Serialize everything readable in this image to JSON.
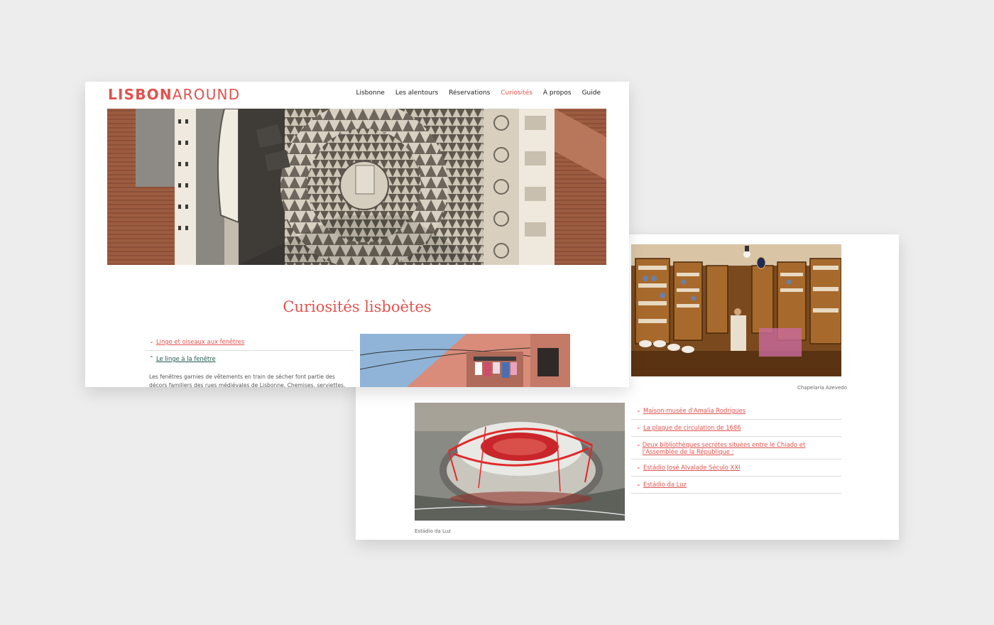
{
  "front": {
    "logo": {
      "bold": "LISBON",
      "light": "AROUND"
    },
    "nav": [
      {
        "label": "Lisbonne",
        "active": false
      },
      {
        "label": "Les alentours",
        "active": false
      },
      {
        "label": "Réservations",
        "active": false
      },
      {
        "label": "Curiosités",
        "active": true
      },
      {
        "label": "À propos",
        "active": false
      },
      {
        "label": "Guide",
        "active": false
      }
    ],
    "title": "Curiosités lisboètes",
    "accordion": [
      {
        "label": "Linge et oiseaux aux fenêtres",
        "icon": "chevron-down-icon",
        "expanded": false
      },
      {
        "label": "Le linge à la fenêtre",
        "icon": "chevron-up-icon",
        "expanded": true
      }
    ],
    "body_text": "Les fenêtres garnies de vêtements en train de sécher font partie des décors familiers des rues médiévales de Lisbonne. Chemises, serviettes, T-shirts"
  },
  "back": {
    "caption_top": "Chapelaria Azevedo",
    "caption_bottom": "Estádio da Luz",
    "accordion": [
      {
        "label": "Maison-musée d'Amalia Rodrigues",
        "icon": "chevron-down-icon"
      },
      {
        "label": "La plaque de circulation de 1686",
        "icon": "chevron-down-icon"
      },
      {
        "label": "Deux bibliothèques secrètes situées entre le Chiado et l'Assemblée de la République :",
        "icon": "chevron-down-icon"
      },
      {
        "label": "Estádio José Alvalade Século XXI",
        "icon": "chevron-down-icon"
      },
      {
        "label": "Estádio da Luz",
        "icon": "chevron-down-icon"
      }
    ]
  },
  "colors": {
    "accent": "#e0534e",
    "link_active": "#1e5a4c",
    "background": "#ededed"
  }
}
